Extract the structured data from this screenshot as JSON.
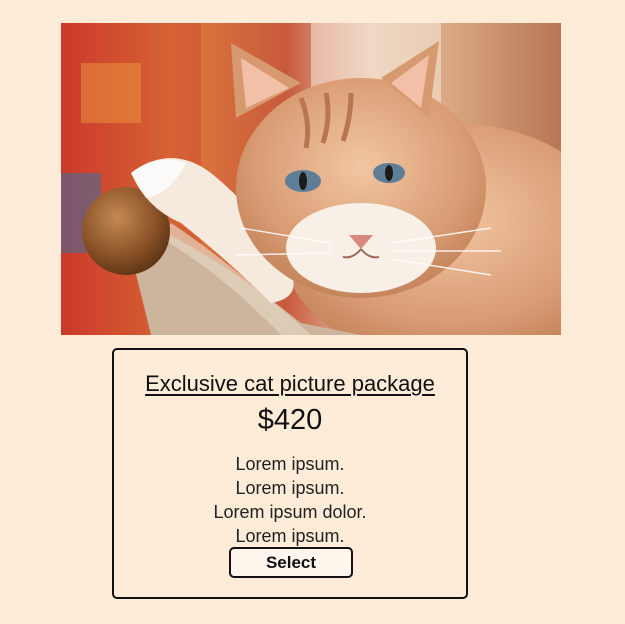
{
  "image": {
    "subject": "orange-tabby-cat-photo"
  },
  "card": {
    "title": "Exclusive cat picture package",
    "price": "$420",
    "features": [
      "Lorem ipsum.",
      "Lorem ipsum.",
      "Lorem ipsum dolor.",
      "Lorem ipsum."
    ],
    "button_label": "Select"
  },
  "colors": {
    "page_background": "#feecd8",
    "card_border": "#111111",
    "button_background": "#fff6ee"
  }
}
